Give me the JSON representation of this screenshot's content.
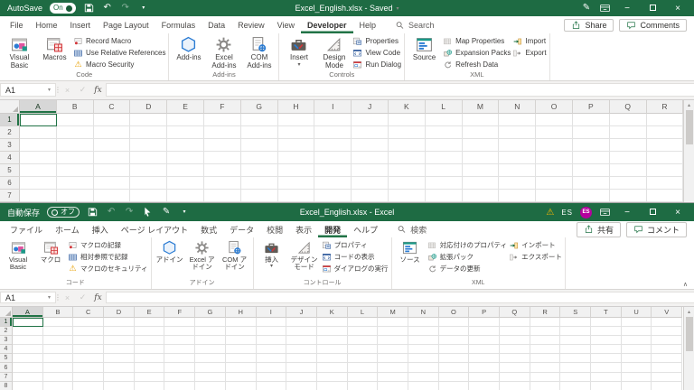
{
  "colors": {
    "titlebar_green": "#1e6b43",
    "accent_green": "#217346",
    "warning_yellow": "#ffb900",
    "avatar_magenta": "#b4009e"
  },
  "icons": {
    "undo": "↶",
    "redo": "↷",
    "pencil": "✎",
    "warning": "⚠",
    "caret_down": "▾",
    "title_caret": "▾",
    "check": "✓",
    "close": "×",
    "minimize": "−",
    "scroll_up": "▴",
    "collapse": "∧",
    "dots": "⋮"
  },
  "windows": [
    {
      "titlebar": {
        "autosave_label": "AutoSave",
        "autosave_state": "On",
        "title": "Excel_English.xlsx  -  Saved"
      },
      "tabs": [
        "File",
        "Home",
        "Insert",
        "Page Layout",
        "Formulas",
        "Data",
        "Review",
        "View",
        "Developer",
        "Help"
      ],
      "search_label": "Search",
      "share_label": "Share",
      "comments_label": "Comments",
      "ribbon": {
        "code": {
          "vb": "Visual Basic",
          "macros": "Macros",
          "record": "Record Macro",
          "relative": "Use Relative References",
          "security": "Macro Security",
          "label": "Code"
        },
        "addins": {
          "main": "Add-ins",
          "excel": "Excel Add-ins",
          "com": "COM Add-ins",
          "label": "Add-ins"
        },
        "controls": {
          "insert": "Insert",
          "design": "Design Mode",
          "properties": "Properties",
          "viewcode": "View Code",
          "rundialog": "Run Dialog",
          "label": "Controls"
        },
        "xml": {
          "source": "Source",
          "map": "Map Properties",
          "expansion": "Expansion Packs",
          "refresh": "Refresh Data",
          "import": "Import",
          "export": "Export",
          "label": "XML"
        }
      },
      "formula_bar": {
        "name_box": "A1",
        "fx": "fx"
      },
      "grid": {
        "columns": [
          "A",
          "B",
          "C",
          "D",
          "E",
          "F",
          "G",
          "H",
          "I",
          "J",
          "K",
          "L",
          "M",
          "N",
          "O",
          "P",
          "Q",
          "R"
        ],
        "rows": 7,
        "selected_col": "A",
        "selected_row": 1
      }
    },
    {
      "titlebar": {
        "autosave_label": "自動保存",
        "autosave_state": "オフ",
        "title": "Excel_English.xlsx  -  Excel",
        "language_badge": "ES",
        "avatar_initials": "ES"
      },
      "tabs": [
        "ファイル",
        "ホーム",
        "挿入",
        "ページ レイアウト",
        "数式",
        "データ",
        "校閲",
        "表示",
        "開発",
        "ヘルプ"
      ],
      "search_label": "検索",
      "share_label": "共有",
      "comments_label": "コメント",
      "ribbon": {
        "code": {
          "vb": "Visual Basic",
          "macros": "マクロ",
          "record": "マクロの記録",
          "relative": "相対参照で記録",
          "security": "マクロのセキュリティ",
          "label": "コード"
        },
        "addins": {
          "main": "アドイン",
          "excel": "Excel アドイン",
          "com": "COM アドイン",
          "label": "アドイン"
        },
        "controls": {
          "insert": "挿入",
          "design": "デザイン モード",
          "properties": "プロパティ",
          "viewcode": "コードの表示",
          "rundialog": "ダイアログの実行",
          "label": "コントロール"
        },
        "xml": {
          "source": "ソース",
          "map": "対応付けのプロパティ",
          "expansion": "拡張パック",
          "refresh": "データの更新",
          "import": "インポート",
          "export": "エクスポート",
          "label": "XML"
        }
      },
      "formula_bar": {
        "name_box": "A1",
        "fx": "fx"
      },
      "grid": {
        "columns": [
          "A",
          "B",
          "C",
          "D",
          "E",
          "F",
          "G",
          "H",
          "I",
          "J",
          "K",
          "L",
          "M",
          "N",
          "O",
          "P",
          "Q",
          "R",
          "S",
          "T",
          "U",
          "V"
        ],
        "rows": 8,
        "selected_col": "A",
        "selected_row": 1
      }
    }
  ]
}
